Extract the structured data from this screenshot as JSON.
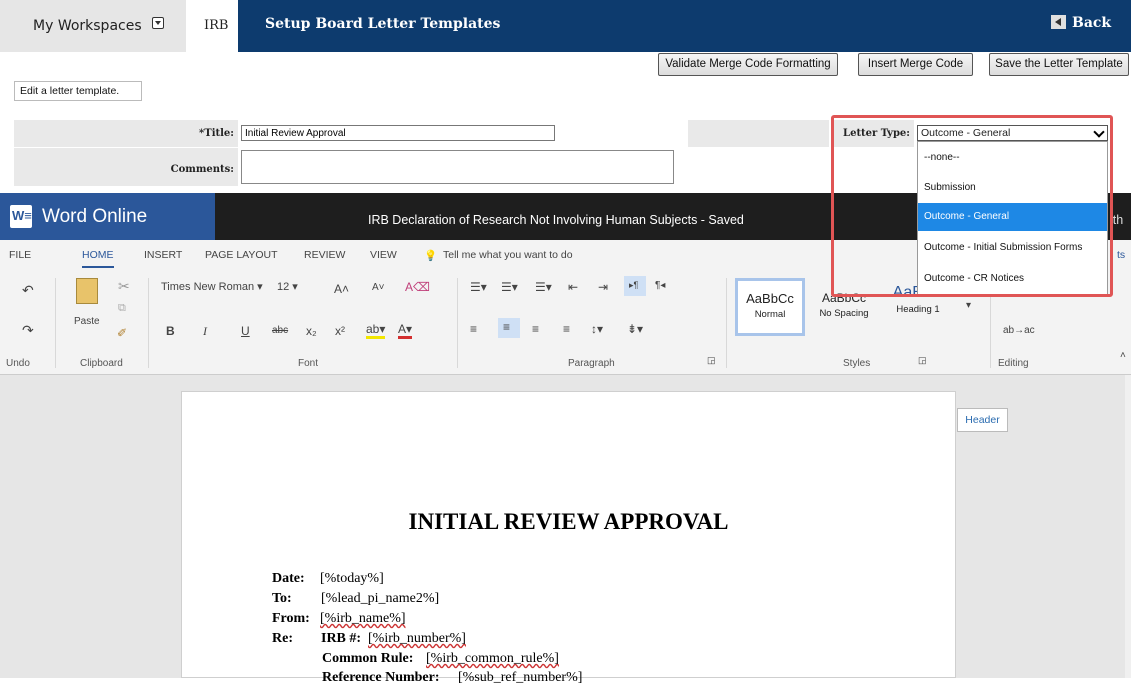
{
  "nav": {
    "workspaces": "My Workspaces",
    "irb": "IRB",
    "title": "Setup Board Letter Templates",
    "back": "Back"
  },
  "toolbar": {
    "validate": "Validate Merge Code Formatting",
    "insert": "Insert Merge Code",
    "save": "Save the Letter Template"
  },
  "hint": "Edit a letter template.",
  "form": {
    "title_label": "*Title:",
    "title_value": "Initial Review Approval",
    "comments_label": "Comments:",
    "letter_type_label": "Letter Type:",
    "letter_type_value": "Outcome - General",
    "options": [
      "--none--",
      "Submission",
      "Outcome - General",
      "Outcome - Initial Submission Forms",
      "Outcome - CR Notices"
    ],
    "selected_index": 2
  },
  "word": {
    "app": "Word Online",
    "doc_title": "IRB Declaration of Research Not Involving Human Subjects   -   Saved",
    "user_partial": "ith",
    "tabs": [
      "FILE",
      "HOME",
      "INSERT",
      "PAGE LAYOUT",
      "REVIEW",
      "VIEW"
    ],
    "tell_me": "Tell me what you want to do",
    "ribbon_right_partial": "ts",
    "font_name": "Times New Roman",
    "font_size": "12",
    "paste": "Paste",
    "groups": [
      "Undo",
      "Clipboard",
      "Font",
      "Paragraph",
      "Styles",
      "Editing"
    ],
    "styles": [
      {
        "sample": "AaBbCc",
        "name": "Normal"
      },
      {
        "sample": "AaBbCc",
        "name": "No Spacing"
      },
      {
        "sample": "AaBbC",
        "name": "Heading 1"
      }
    ],
    "header_button": "Header"
  },
  "document": {
    "heading": "INITIAL REVIEW APPROVAL",
    "lines": [
      {
        "label": "Date:",
        "value": "[%today%]"
      },
      {
        "label": "To:",
        "value": "[%lead_pi_name2%]"
      },
      {
        "label": "From:",
        "value": "[%irb_name%]"
      },
      {
        "label": "Re:",
        "value": ""
      }
    ],
    "irb_label": "IRB #:",
    "irb_value": "[%irb_number%]",
    "common_rule_label": "Common Rule:",
    "common_rule_value": "[%irb_common_rule%]",
    "ref_label": "Reference Number:",
    "ref_value": "[%sub_ref_number%]"
  },
  "colors": {
    "nav_blue": "#0d3b6e",
    "word_blue": "#2b579a",
    "highlight": "#e05555",
    "selected": "#1e88e5"
  }
}
